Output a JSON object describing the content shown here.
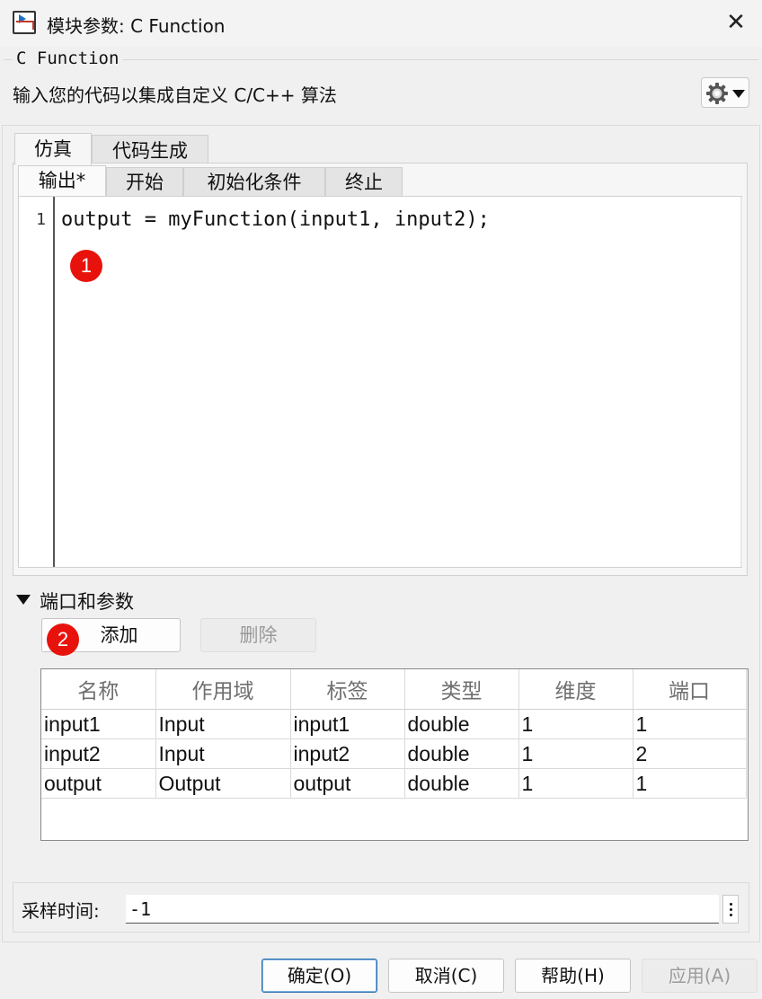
{
  "window": {
    "title": "模块参数: C Function",
    "close_symbol": "✕"
  },
  "block": {
    "name": "C Function",
    "description": "输入您的代码以集成自定义 C/C++ 算法"
  },
  "tabs": {
    "outer": [
      "仿真",
      "代码生成"
    ],
    "inner": [
      "输出*",
      "开始",
      "初始化条件",
      "终止"
    ]
  },
  "editor": {
    "line_number": "1",
    "code": "output = myFunction(input1, input2);"
  },
  "badges": {
    "first": "1",
    "second": "2"
  },
  "ports": {
    "section_title": "端口和参数",
    "add_label": "添加",
    "delete_label": "删除",
    "columns": [
      "名称",
      "作用域",
      "标签",
      "类型",
      "维度",
      "端口"
    ],
    "rows": [
      [
        "input1",
        "Input",
        "input1",
        "double",
        "1",
        "1"
      ],
      [
        "input2",
        "Input",
        "input2",
        "double",
        "1",
        "2"
      ],
      [
        "output",
        "Output",
        "output",
        "double",
        "1",
        "1"
      ]
    ]
  },
  "sample_time": {
    "label": "采样时间:",
    "value": "-1"
  },
  "buttons": {
    "ok": "确定(O)",
    "cancel": "取消(C)",
    "help": "帮助(H)",
    "apply": "应用(A)"
  },
  "colors": {
    "badge": "#e8120c",
    "ok_border": "#2e6fb0"
  },
  "icons": {
    "app": "simulink-block-icon",
    "close": "close-icon",
    "settings": "gear-icon",
    "dropdown": "chevron-down-icon",
    "collapse": "triangle-down-icon",
    "more": "vertical-ellipsis-icon"
  }
}
